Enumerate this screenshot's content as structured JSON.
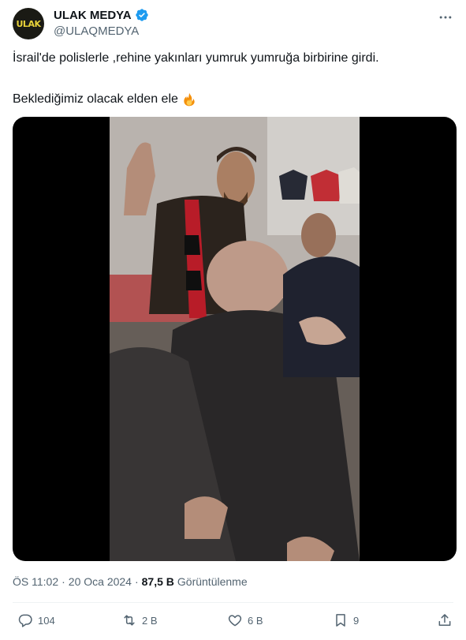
{
  "account": {
    "avatar_text": "ULAK",
    "display_name": "ULAK MEDYA",
    "handle": "@ULAQMEDYA",
    "verified_icon": "verified-badge-icon"
  },
  "tweet": {
    "line1": "İsrail'de polislerle ,rehine yakınları yumruk yumruğa birbirine girdi.",
    "line2": "Beklediğimiz olacak elden ele",
    "emoji_icon": "fire-icon"
  },
  "media": {
    "type": "video"
  },
  "meta": {
    "time": "ÖS 11:02",
    "date": "20 Oca 2024",
    "views_count": "87,5 B",
    "views_label": "Görüntülenme"
  },
  "actions": {
    "replies": "104",
    "retweets": "2 B",
    "likes": "6 B",
    "bookmarks": "9"
  },
  "colors": {
    "text": "#0f1419",
    "secondary": "#536471",
    "verified": "#1d9bf0",
    "divider": "#eff3f4"
  }
}
